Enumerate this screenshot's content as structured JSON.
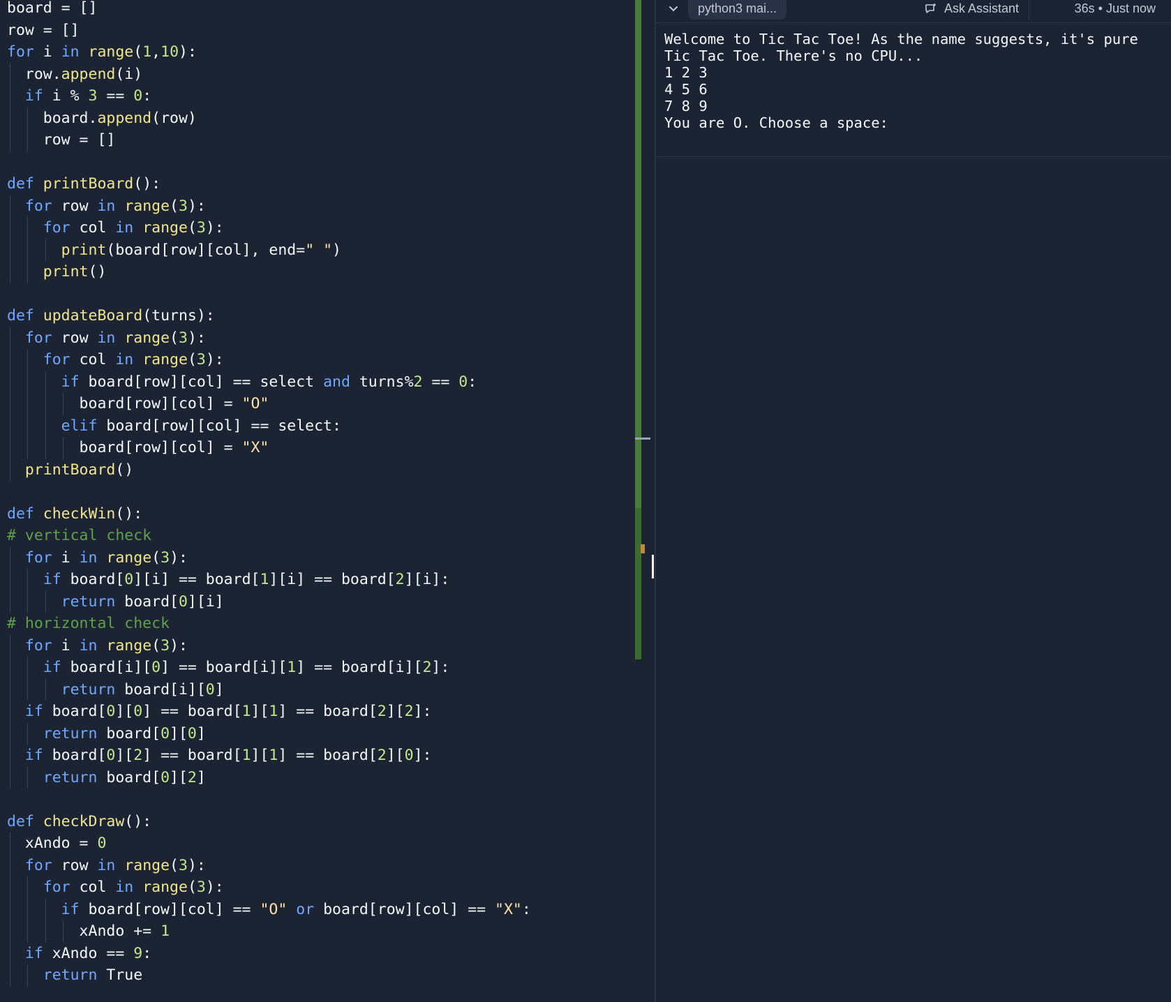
{
  "editor": {
    "lines": [
      [
        [
          "p",
          "board = []"
        ]
      ],
      [
        [
          "p",
          "row = []"
        ]
      ],
      [
        [
          "k",
          "for"
        ],
        [
          "p",
          " i "
        ],
        [
          "k",
          "in"
        ],
        [
          "p",
          " "
        ],
        [
          "f",
          "range"
        ],
        [
          "p",
          "("
        ],
        [
          "n",
          "1"
        ],
        [
          "p",
          ","
        ],
        [
          "n",
          "10"
        ],
        [
          "p",
          "):"
        ]
      ],
      [
        [
          "p",
          "  row."
        ],
        [
          "f",
          "append"
        ],
        [
          "p",
          "(i)"
        ]
      ],
      [
        [
          "p",
          "  "
        ],
        [
          "k",
          "if"
        ],
        [
          "p",
          " i % "
        ],
        [
          "n",
          "3"
        ],
        [
          "p",
          " == "
        ],
        [
          "n",
          "0"
        ],
        [
          "p",
          ":"
        ]
      ],
      [
        [
          "p",
          "    board."
        ],
        [
          "f",
          "append"
        ],
        [
          "p",
          "(row)"
        ]
      ],
      [
        [
          "p",
          "    row = []"
        ]
      ],
      [
        [
          "p",
          ""
        ]
      ],
      [
        [
          "k",
          "def"
        ],
        [
          "p",
          " "
        ],
        [
          "f",
          "printBoard"
        ],
        [
          "p",
          "():"
        ]
      ],
      [
        [
          "p",
          "  "
        ],
        [
          "k",
          "for"
        ],
        [
          "p",
          " row "
        ],
        [
          "k",
          "in"
        ],
        [
          "p",
          " "
        ],
        [
          "f",
          "range"
        ],
        [
          "p",
          "("
        ],
        [
          "n",
          "3"
        ],
        [
          "p",
          "):"
        ]
      ],
      [
        [
          "p",
          "    "
        ],
        [
          "k",
          "for"
        ],
        [
          "p",
          " col "
        ],
        [
          "k",
          "in"
        ],
        [
          "p",
          " "
        ],
        [
          "f",
          "range"
        ],
        [
          "p",
          "("
        ],
        [
          "n",
          "3"
        ],
        [
          "p",
          "):"
        ]
      ],
      [
        [
          "p",
          "      "
        ],
        [
          "f",
          "print"
        ],
        [
          "p",
          "(board[row][col], end="
        ],
        [
          "s",
          "\" \""
        ],
        [
          "p",
          ")"
        ]
      ],
      [
        [
          "p",
          "    "
        ],
        [
          "f",
          "print"
        ],
        [
          "p",
          "()"
        ]
      ],
      [
        [
          "p",
          ""
        ]
      ],
      [
        [
          "k",
          "def"
        ],
        [
          "p",
          " "
        ],
        [
          "f",
          "updateBoard"
        ],
        [
          "p",
          "(turns):"
        ]
      ],
      [
        [
          "p",
          "  "
        ],
        [
          "k",
          "for"
        ],
        [
          "p",
          " row "
        ],
        [
          "k",
          "in"
        ],
        [
          "p",
          " "
        ],
        [
          "f",
          "range"
        ],
        [
          "p",
          "("
        ],
        [
          "n",
          "3"
        ],
        [
          "p",
          "):"
        ]
      ],
      [
        [
          "p",
          "    "
        ],
        [
          "k",
          "for"
        ],
        [
          "p",
          " col "
        ],
        [
          "k",
          "in"
        ],
        [
          "p",
          " "
        ],
        [
          "f",
          "range"
        ],
        [
          "p",
          "("
        ],
        [
          "n",
          "3"
        ],
        [
          "p",
          "):"
        ]
      ],
      [
        [
          "p",
          "      "
        ],
        [
          "k",
          "if"
        ],
        [
          "p",
          " board[row][col] == select "
        ],
        [
          "k",
          "and"
        ],
        [
          "p",
          " turns%"
        ],
        [
          "n",
          "2"
        ],
        [
          "p",
          " == "
        ],
        [
          "n",
          "0"
        ],
        [
          "p",
          ":"
        ]
      ],
      [
        [
          "p",
          "        board[row][col] = "
        ],
        [
          "s",
          "\"O\""
        ]
      ],
      [
        [
          "p",
          "      "
        ],
        [
          "k",
          "elif"
        ],
        [
          "p",
          " board[row][col] == select:"
        ]
      ],
      [
        [
          "p",
          "        board[row][col] = "
        ],
        [
          "s",
          "\"X\""
        ]
      ],
      [
        [
          "p",
          "  "
        ],
        [
          "f",
          "printBoard"
        ],
        [
          "p",
          "()"
        ]
      ],
      [
        [
          "p",
          ""
        ]
      ],
      [
        [
          "k",
          "def"
        ],
        [
          "p",
          " "
        ],
        [
          "f",
          "checkWin"
        ],
        [
          "p",
          "():"
        ]
      ],
      [
        [
          "c",
          "# vertical check"
        ]
      ],
      [
        [
          "p",
          "  "
        ],
        [
          "k",
          "for"
        ],
        [
          "p",
          " i "
        ],
        [
          "k",
          "in"
        ],
        [
          "p",
          " "
        ],
        [
          "f",
          "range"
        ],
        [
          "p",
          "("
        ],
        [
          "n",
          "3"
        ],
        [
          "p",
          "):"
        ]
      ],
      [
        [
          "p",
          "    "
        ],
        [
          "k",
          "if"
        ],
        [
          "p",
          " board["
        ],
        [
          "n",
          "0"
        ],
        [
          "p",
          "][i] == board["
        ],
        [
          "n",
          "1"
        ],
        [
          "p",
          "][i] == board["
        ],
        [
          "n",
          "2"
        ],
        [
          "p",
          "][i]:"
        ]
      ],
      [
        [
          "p",
          "      "
        ],
        [
          "k",
          "return"
        ],
        [
          "p",
          " board["
        ],
        [
          "n",
          "0"
        ],
        [
          "p",
          "][i]"
        ]
      ],
      [
        [
          "c",
          "# horizontal check"
        ]
      ],
      [
        [
          "p",
          "  "
        ],
        [
          "k",
          "for"
        ],
        [
          "p",
          " i "
        ],
        [
          "k",
          "in"
        ],
        [
          "p",
          " "
        ],
        [
          "f",
          "range"
        ],
        [
          "p",
          "("
        ],
        [
          "n",
          "3"
        ],
        [
          "p",
          "):"
        ]
      ],
      [
        [
          "p",
          "    "
        ],
        [
          "k",
          "if"
        ],
        [
          "p",
          " board[i]["
        ],
        [
          "n",
          "0"
        ],
        [
          "p",
          "] == board[i]["
        ],
        [
          "n",
          "1"
        ],
        [
          "p",
          "] == board[i]["
        ],
        [
          "n",
          "2"
        ],
        [
          "p",
          "]:"
        ]
      ],
      [
        [
          "p",
          "      "
        ],
        [
          "k",
          "return"
        ],
        [
          "p",
          " board[i]["
        ],
        [
          "n",
          "0"
        ],
        [
          "p",
          "]"
        ]
      ],
      [
        [
          "p",
          "  "
        ],
        [
          "k",
          "if"
        ],
        [
          "p",
          " board["
        ],
        [
          "n",
          "0"
        ],
        [
          "p",
          "]["
        ],
        [
          "n",
          "0"
        ],
        [
          "p",
          "] == board["
        ],
        [
          "n",
          "1"
        ],
        [
          "p",
          "]["
        ],
        [
          "n",
          "1"
        ],
        [
          "p",
          "] == board["
        ],
        [
          "n",
          "2"
        ],
        [
          "p",
          "]["
        ],
        [
          "n",
          "2"
        ],
        [
          "p",
          "]:"
        ]
      ],
      [
        [
          "p",
          "    "
        ],
        [
          "k",
          "return"
        ],
        [
          "p",
          " board["
        ],
        [
          "n",
          "0"
        ],
        [
          "p",
          "]["
        ],
        [
          "n",
          "0"
        ],
        [
          "p",
          "]"
        ]
      ],
      [
        [
          "p",
          "  "
        ],
        [
          "k",
          "if"
        ],
        [
          "p",
          " board["
        ],
        [
          "n",
          "0"
        ],
        [
          "p",
          "]["
        ],
        [
          "n",
          "2"
        ],
        [
          "p",
          "] == board["
        ],
        [
          "n",
          "1"
        ],
        [
          "p",
          "]["
        ],
        [
          "n",
          "1"
        ],
        [
          "p",
          "] == board["
        ],
        [
          "n",
          "2"
        ],
        [
          "p",
          "]["
        ],
        [
          "n",
          "0"
        ],
        [
          "p",
          "]:"
        ]
      ],
      [
        [
          "p",
          "    "
        ],
        [
          "k",
          "return"
        ],
        [
          "p",
          " board["
        ],
        [
          "n",
          "0"
        ],
        [
          "p",
          "]["
        ],
        [
          "n",
          "2"
        ],
        [
          "p",
          "]"
        ]
      ],
      [
        [
          "p",
          ""
        ]
      ],
      [
        [
          "k",
          "def"
        ],
        [
          "p",
          " "
        ],
        [
          "f",
          "checkDraw"
        ],
        [
          "p",
          "():"
        ]
      ],
      [
        [
          "p",
          "  xAndo = "
        ],
        [
          "n",
          "0"
        ]
      ],
      [
        [
          "p",
          "  "
        ],
        [
          "k",
          "for"
        ],
        [
          "p",
          " row "
        ],
        [
          "k",
          "in"
        ],
        [
          "p",
          " "
        ],
        [
          "f",
          "range"
        ],
        [
          "p",
          "("
        ],
        [
          "n",
          "3"
        ],
        [
          "p",
          "):"
        ]
      ],
      [
        [
          "p",
          "    "
        ],
        [
          "k",
          "for"
        ],
        [
          "p",
          " col "
        ],
        [
          "k",
          "in"
        ],
        [
          "p",
          " "
        ],
        [
          "f",
          "range"
        ],
        [
          "p",
          "("
        ],
        [
          "n",
          "3"
        ],
        [
          "p",
          "):"
        ]
      ],
      [
        [
          "p",
          "      "
        ],
        [
          "k",
          "if"
        ],
        [
          "p",
          " board[row][col] == "
        ],
        [
          "s",
          "\"O\""
        ],
        [
          "p",
          " "
        ],
        [
          "k",
          "or"
        ],
        [
          "p",
          " board[row][col] == "
        ],
        [
          "s",
          "\"X\""
        ],
        [
          "p",
          ":"
        ]
      ],
      [
        [
          "p",
          "        xAndo += "
        ],
        [
          "n",
          "1"
        ]
      ],
      [
        [
          "p",
          "  "
        ],
        [
          "k",
          "if"
        ],
        [
          "p",
          " xAndo == "
        ],
        [
          "n",
          "9"
        ],
        [
          "p",
          ":"
        ]
      ],
      [
        [
          "p",
          "    "
        ],
        [
          "k",
          "return"
        ],
        [
          "p",
          " True"
        ]
      ],
      [
        [
          "p",
          ""
        ]
      ]
    ]
  },
  "console": {
    "tab_label": "python3 mai...",
    "ask_label": "Ask Assistant",
    "status": "36s • Just now",
    "output": "Welcome to Tic Tac Toe! As the name suggests, it's pure\nTic Tac Toe. There's no CPU...\n1 2 3\n4 5 6\n7 8 9\nYou are O. Choose a space:",
    "icons": {
      "collapse": "chevron-down-icon",
      "assistant": "chat-icon"
    }
  }
}
